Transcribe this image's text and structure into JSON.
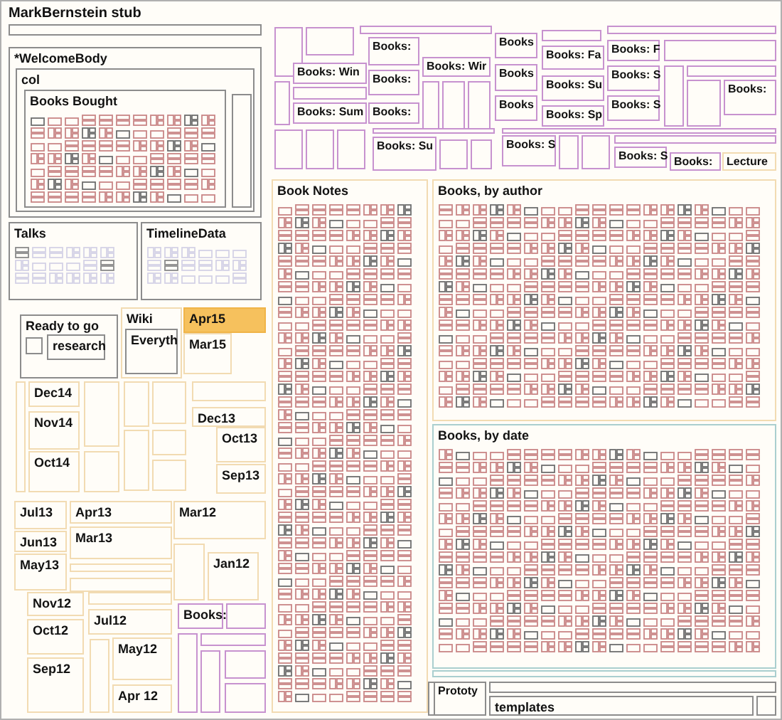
{
  "title": "MarkBernstein stub",
  "nodes": [
    {
      "label": "*WelcomeBody",
      "kind": "note",
      "selected": false
    },
    {
      "label": "col",
      "kind": "note",
      "selected": false
    },
    {
      "label": "Books Bought",
      "kind": "note",
      "selected": false
    },
    {
      "label": "Talks",
      "kind": "note",
      "selected": false
    },
    {
      "label": "TimelineData",
      "kind": "note",
      "selected": false
    },
    {
      "label": "Ready to go",
      "kind": "note",
      "selected": false
    },
    {
      "label": "research",
      "kind": "note",
      "selected": false
    },
    {
      "label": "Wiki",
      "kind": "period",
      "selected": false
    },
    {
      "label": "Everyth",
      "kind": "note",
      "selected": false
    },
    {
      "label": "Apr15",
      "kind": "period",
      "selected": true
    },
    {
      "label": "Mar15",
      "kind": "period",
      "selected": false
    },
    {
      "label": "Dec14",
      "kind": "period",
      "selected": false
    },
    {
      "label": "Nov14",
      "kind": "period",
      "selected": false
    },
    {
      "label": "Oct14",
      "kind": "period",
      "selected": false
    },
    {
      "label": "Dec13",
      "kind": "period",
      "selected": false
    },
    {
      "label": "Oct13",
      "kind": "period",
      "selected": false
    },
    {
      "label": "Sep13",
      "kind": "period",
      "selected": false
    },
    {
      "label": "Jul13",
      "kind": "period",
      "selected": false
    },
    {
      "label": "Apr13",
      "kind": "period",
      "selected": false
    },
    {
      "label": "Mar12",
      "kind": "period",
      "selected": false
    },
    {
      "label": "Jun13",
      "kind": "period",
      "selected": false
    },
    {
      "label": "Mar13",
      "kind": "period",
      "selected": false
    },
    {
      "label": "May13",
      "kind": "period",
      "selected": false
    },
    {
      "label": "Jan12",
      "kind": "period",
      "selected": false
    },
    {
      "label": "Nov12",
      "kind": "period",
      "selected": false
    },
    {
      "label": "Jul12",
      "kind": "period",
      "selected": false
    },
    {
      "label": "Oct12",
      "kind": "period",
      "selected": false
    },
    {
      "label": "Books:",
      "kind": "book",
      "selected": false
    },
    {
      "label": "Sep12",
      "kind": "period",
      "selected": false
    },
    {
      "label": "May12",
      "kind": "period",
      "selected": false
    },
    {
      "label": "Apr 12",
      "kind": "period",
      "selected": false
    },
    {
      "label": "Books:",
      "kind": "book",
      "selected": false
    },
    {
      "label": "Books: Win",
      "kind": "book",
      "selected": false
    },
    {
      "label": "Books: Wir",
      "kind": "book",
      "selected": false
    },
    {
      "label": "Books:",
      "kind": "book",
      "selected": false
    },
    {
      "label": "Books: Sum",
      "kind": "book",
      "selected": false
    },
    {
      "label": "Books:",
      "kind": "book",
      "selected": false
    },
    {
      "label": "Books",
      "kind": "book",
      "selected": false
    },
    {
      "label": "Books",
      "kind": "book",
      "selected": false
    },
    {
      "label": "Books",
      "kind": "book",
      "selected": false
    },
    {
      "label": "Books: Fa",
      "kind": "book",
      "selected": false
    },
    {
      "label": "Books: Su",
      "kind": "book",
      "selected": false
    },
    {
      "label": "Books: Sp",
      "kind": "book",
      "selected": false
    },
    {
      "label": "Books: F",
      "kind": "book",
      "selected": false
    },
    {
      "label": "Books: S",
      "kind": "book",
      "selected": false
    },
    {
      "label": "Books: S",
      "kind": "book",
      "selected": false
    },
    {
      "label": "Books:",
      "kind": "book",
      "selected": false
    },
    {
      "label": "Books: Su",
      "kind": "book",
      "selected": false
    },
    {
      "label": "Books: S",
      "kind": "book",
      "selected": false
    },
    {
      "label": "Books: S",
      "kind": "book",
      "selected": false
    },
    {
      "label": "Books:",
      "kind": "book",
      "selected": false
    },
    {
      "label": "Lecture",
      "kind": "period",
      "selected": false
    },
    {
      "label": "Book Notes",
      "kind": "period",
      "selected": false
    },
    {
      "label": "Books, by author",
      "kind": "period",
      "selected": false
    },
    {
      "label": "Books, by date",
      "kind": "collection",
      "selected": false
    },
    {
      "label": "Prototy",
      "kind": "note",
      "selected": false
    },
    {
      "label": "templates",
      "kind": "note",
      "selected": false
    }
  ]
}
